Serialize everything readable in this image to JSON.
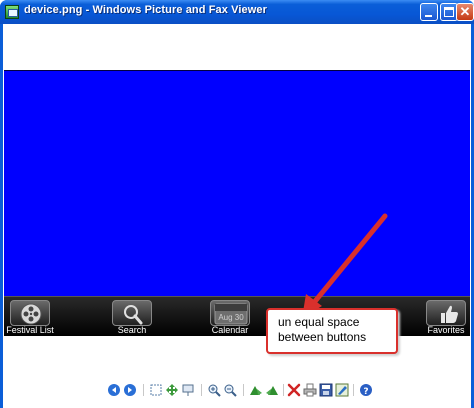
{
  "window": {
    "title": "device.png - Windows Picture and Fax Viewer",
    "close_glyph": "✕"
  },
  "image": {
    "tabs": [
      {
        "label": "Festival List",
        "icon": "film-reel-icon"
      },
      {
        "label": "Search",
        "icon": "magnifier-icon"
      },
      {
        "label": "Calendar",
        "icon": "calendar-icon",
        "date_text": "Aug 30"
      },
      {
        "label": "Favorites",
        "icon": "thumbs-up-icon"
      }
    ]
  },
  "annotation": {
    "line1": "un equal space",
    "line2": "between buttons",
    "arrow_color": "#d9302c"
  },
  "toolbar": {
    "buttons": [
      "previous-image-icon",
      "next-image-icon",
      "best-fit-icon",
      "actual-size-icon",
      "slideshow-icon",
      "zoom-in-icon",
      "zoom-out-icon",
      "rotate-clockwise-icon",
      "rotate-counterclockwise-icon",
      "delete-icon",
      "print-icon",
      "save-icon",
      "edit-icon",
      "help-icon"
    ]
  },
  "colors": {
    "screen_blue": "#0000ff",
    "titlebar_blue": "#0a5ed8",
    "tab_bar": "#000000"
  }
}
